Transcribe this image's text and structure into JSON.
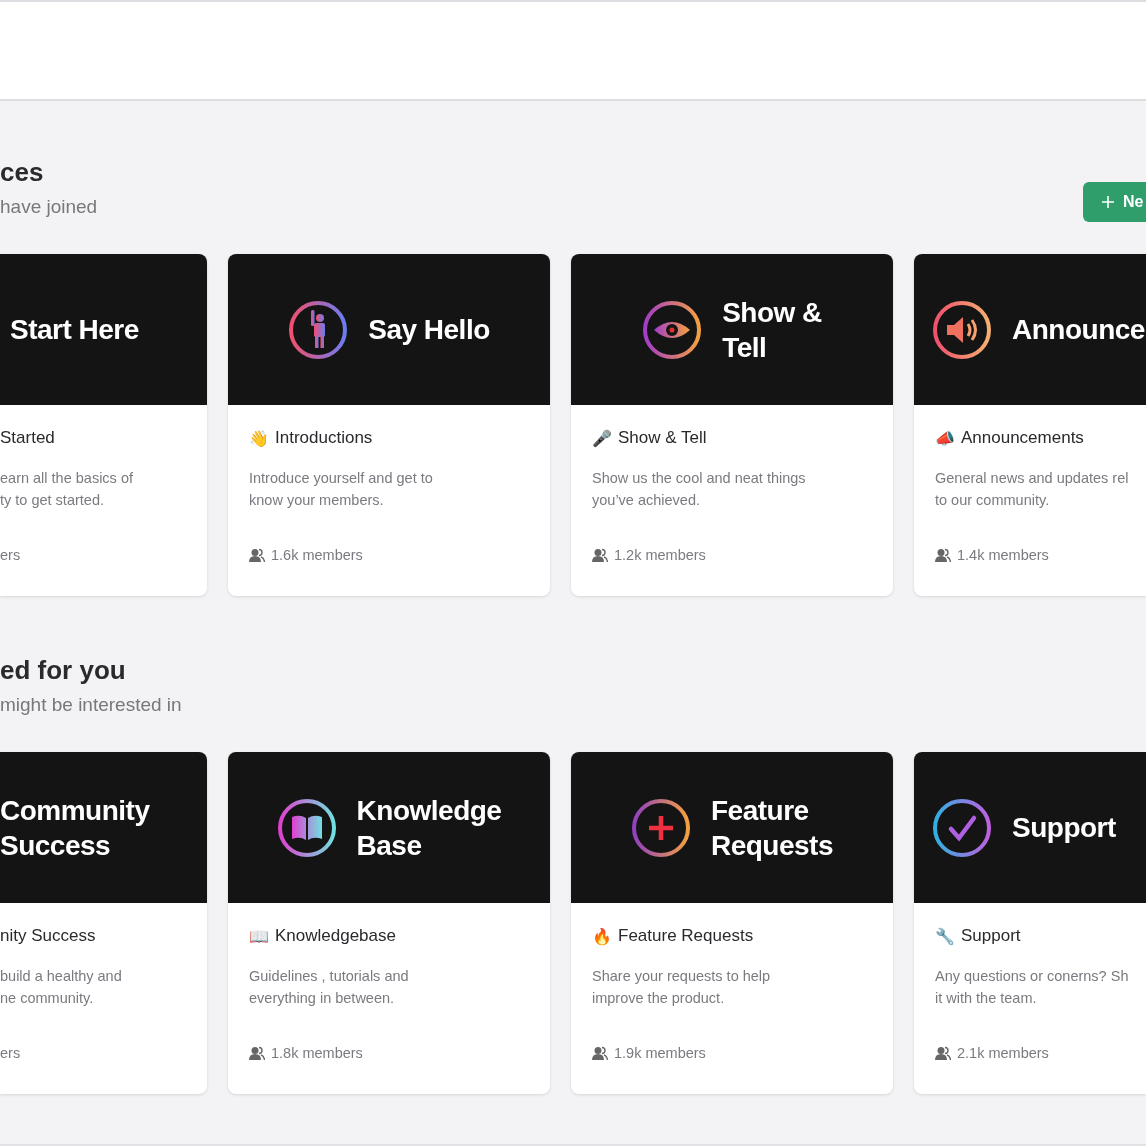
{
  "sections": [
    {
      "title": "ces",
      "subtitle": "have joined",
      "button": {
        "label": "Ne"
      },
      "cards": [
        {
          "kind": "clipped-left",
          "banner_title": "Start Here",
          "title": "Started",
          "description": "earn all the basics of\nty to get started.",
          "members": "ers"
        },
        {
          "kind": "full",
          "banner_title": "Say Hello",
          "emoji": "👋",
          "title": "Introductions",
          "description": "Introduce yourself and get to\nknow your members.",
          "members": "1.6k members"
        },
        {
          "kind": "full",
          "banner_title": "Show &\nTell",
          "emoji": "🎤",
          "title": "Show & Tell",
          "description": "Show us the cool and neat things\nyou’ve achieved.",
          "members": "1.2k members"
        },
        {
          "kind": "clipped-right",
          "banner_title": "Announce",
          "emoji": "📣",
          "title": "Announcements",
          "description": "General news and updates rel\nto our community.",
          "members": "1.4k members"
        }
      ]
    },
    {
      "title": "ed for you",
      "subtitle": "might be interested in",
      "cards": [
        {
          "kind": "clipped-left",
          "banner_title": "Community\nSuccess",
          "title": "nity Success",
          "description": " build a healthy and\nne community.",
          "members": "ers"
        },
        {
          "kind": "full",
          "banner_title": "Knowledge\nBase",
          "emoji": "📖",
          "title": "Knowledgebase",
          "description": "Guidelines , tutorials and\neverything in between.",
          "members": "1.8k members"
        },
        {
          "kind": "full",
          "banner_title": "Feature\nRequests",
          "emoji": "🔥",
          "title": "Feature Requests",
          "description": "Share your requests to help\nimprove the product.",
          "members": "1.9k members"
        },
        {
          "kind": "clipped-right",
          "banner_title": "Support",
          "emoji": "🔧",
          "title": "Support",
          "description": "Any questions or conerns? Sh\nit with the team.",
          "members": "2.1k members"
        }
      ]
    }
  ]
}
